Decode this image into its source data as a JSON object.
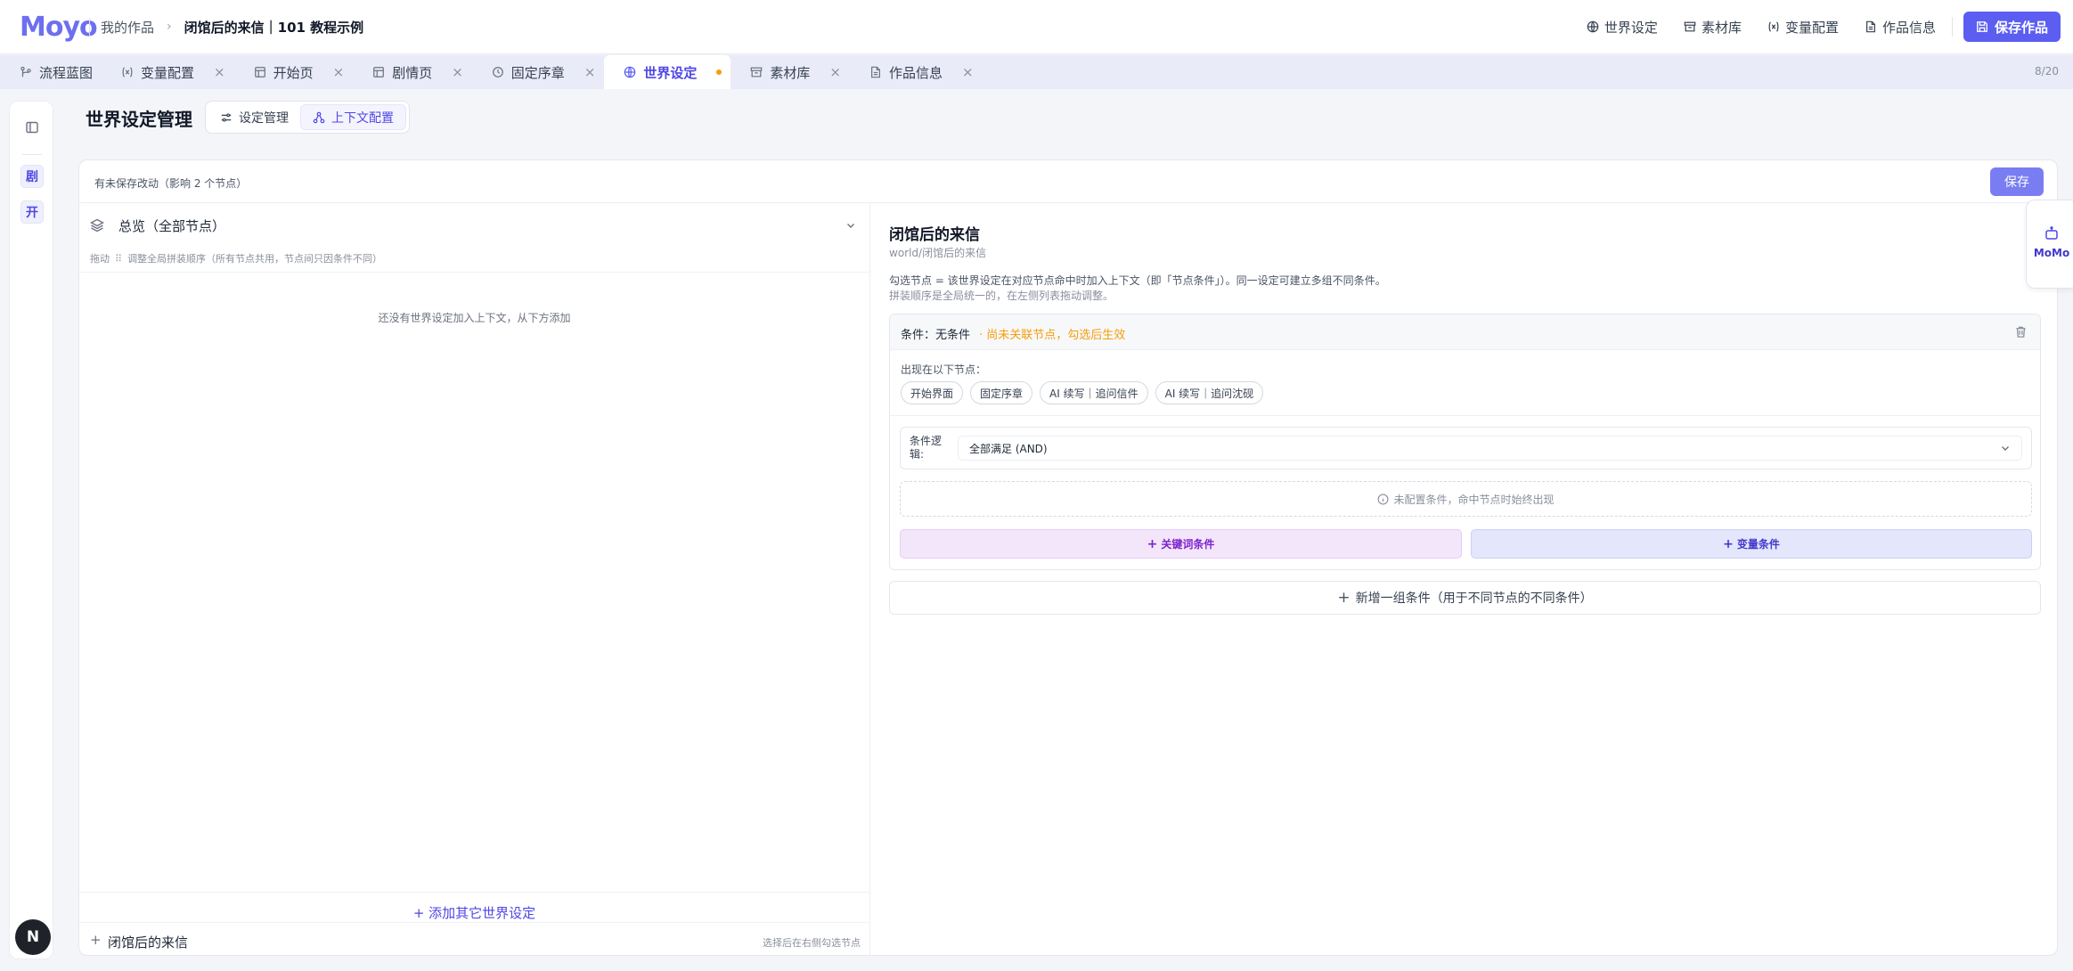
{
  "header": {
    "logo": "Moyo",
    "breadcrumb_root": "我的作品",
    "breadcrumb_current": "闭馆后的来信｜101 教程示例",
    "actions": [
      {
        "label": "世界设定",
        "icon": "globe-icon"
      },
      {
        "label": "素材库",
        "icon": "archive-icon"
      },
      {
        "label": "变量配置",
        "icon": "variable-icon"
      },
      {
        "label": "作品信息",
        "icon": "document-icon"
      }
    ],
    "save_work": "保存作品"
  },
  "tabs": [
    {
      "label": "流程蓝图",
      "icon": "flow-icon",
      "closable": false
    },
    {
      "label": "变量配置",
      "icon": "variable-icon",
      "closable": true
    },
    {
      "label": "开始页",
      "icon": "layout-icon",
      "closable": true
    },
    {
      "label": "剧情页",
      "icon": "layout-icon",
      "closable": true
    },
    {
      "label": "固定序章",
      "icon": "clock-icon",
      "closable": true
    },
    {
      "label": "世界设定",
      "icon": "globe-icon",
      "active": true,
      "unsaved": true
    },
    {
      "label": "素材库",
      "icon": "archive-icon",
      "closable": true
    },
    {
      "label": "作品信息",
      "icon": "document-icon",
      "closable": true
    }
  ],
  "tab_count": "8/20",
  "rail": {
    "items": [
      "剧",
      "开"
    ],
    "badge": "N"
  },
  "page": {
    "title": "世界设定管理",
    "segments": [
      {
        "label": "设定管理",
        "active": false
      },
      {
        "label": "上下文配置",
        "active": true
      }
    ]
  },
  "card": {
    "unsaved_notice": "有未保存改动（影响 2 个节点）",
    "save": "保存"
  },
  "left": {
    "select_value": "总览（全部节点）",
    "hint_prefix": "拖动",
    "hint_text": "调整全局拼装顺序（所有节点共用，节点间只因条件不同）",
    "empty": "还没有世界设定加入上下文，从下方添加",
    "add_other": "+ 添加其它世界设定",
    "footer_item": "闭馆后的来信",
    "footer_hint": "选择后在右侧勾选节点"
  },
  "right": {
    "title": "闭馆后的来信",
    "path": "world/闭馆后的来信",
    "desc1": "勾选节点 = 该世界设定在对应节点命中时加入上下文（即「节点条件」）。同一设定可建立多组不同条件。",
    "desc2": "拼装顺序是全局统一的，在左侧列表拖动调整。",
    "condition": {
      "label": "条件：无条件",
      "warning": "· 尚未关联节点，勾选后生效",
      "appear_label": "出现在以下节点：",
      "nodes": [
        "开始界面",
        "固定序章",
        "AI 续写｜追问信件",
        "AI 续写｜追问沈砚"
      ],
      "logic_label": "条件逻辑:",
      "logic_value": "全部满足 (AND)",
      "no_condition": "未配置条件，命中节点时始终出现",
      "keyword_button": "关键词条件",
      "variable_button": "变量条件"
    },
    "add_group": "新增一组条件（用于不同节点的不同条件）"
  },
  "momo": {
    "label": "MoMo"
  },
  "colors": {
    "accent": "#5b5ef0",
    "warning": "#f59e0b",
    "keyword_bg": "#f3e6fb",
    "variable_bg": "#e4e6fc"
  }
}
